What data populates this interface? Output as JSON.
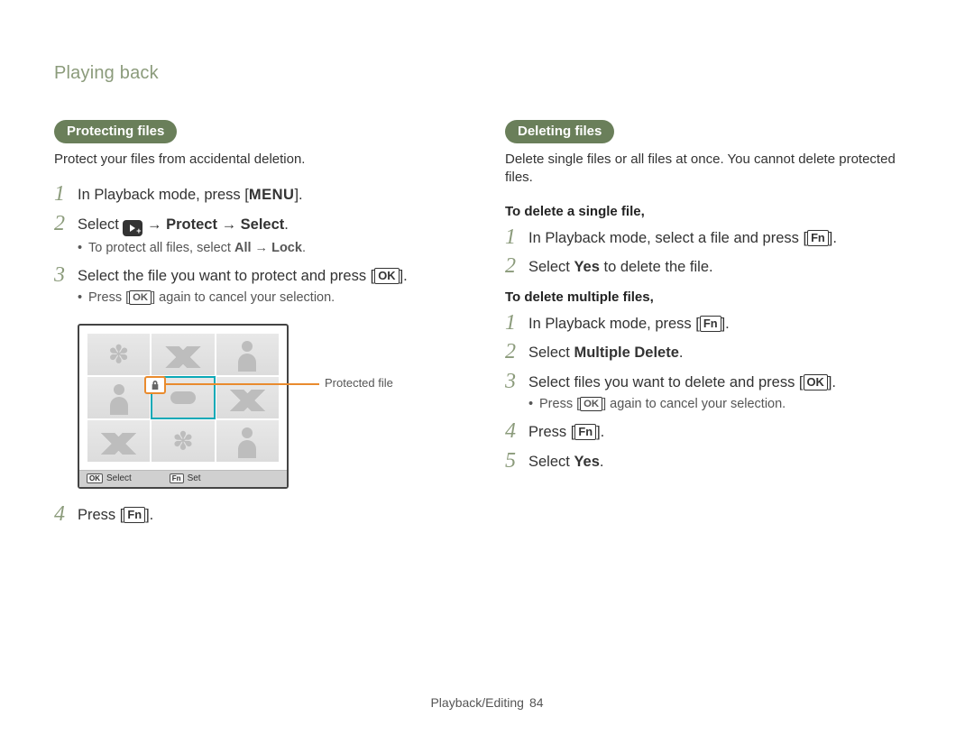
{
  "breadcrumb": "Playing back",
  "left": {
    "pill": "Protecting files",
    "intro": "Protect your files from accidental deletion.",
    "steps": {
      "s1_a": "In Playback mode, press [",
      "s1_menu": "MENU",
      "s1_b": "].",
      "s2_a": "Select ",
      "s2_b": " → ",
      "s2_protect": "Protect",
      "s2_c": " → ",
      "s2_select": "Select",
      "s2_d": ".",
      "s2_sub_a": "To protect all files, select ",
      "s2_sub_all": "All",
      "s2_sub_b": " → ",
      "s2_sub_lock": "Lock",
      "s2_sub_c": ".",
      "s3_a": "Select the file you want to protect and press [",
      "s3_ok": "OK",
      "s3_b": "].",
      "s3_sub_a": "Press [",
      "s3_sub_ok": "OK",
      "s3_sub_b": "] again to cancel your selection.",
      "s4_a": "Press [",
      "s4_fn": "Fn",
      "s4_b": "]."
    },
    "lcd": {
      "callout": "Protected file",
      "f1_key": "OK",
      "f1_label": "Select",
      "f2_key": "Fn",
      "f2_label": "Set"
    }
  },
  "right": {
    "pill": "Deleting files",
    "intro": "Delete single files or all files at once. You cannot delete protected files.",
    "sub1": "To delete a single file,",
    "single": {
      "s1_a": "In Playback mode, select a file and press [",
      "s1_fn": "Fn",
      "s1_b": "].",
      "s2_a": "Select ",
      "s2_yes": "Yes",
      "s2_b": " to delete the file."
    },
    "sub2": "To delete multiple files,",
    "multi": {
      "s1_a": "In Playback mode, press [",
      "s1_fn": "Fn",
      "s1_b": "].",
      "s2_a": "Select ",
      "s2_md": "Multiple Delete",
      "s2_b": ".",
      "s3_a": "Select files you want to delete and press [",
      "s3_ok": "OK",
      "s3_b": "].",
      "s3_sub_a": "Press [",
      "s3_sub_ok": "OK",
      "s3_sub_b": "] again to cancel your selection.",
      "s4_a": "Press [",
      "s4_fn": "Fn",
      "s4_b": "].",
      "s5_a": "Select ",
      "s5_yes": "Yes",
      "s5_b": "."
    }
  },
  "footer": {
    "section": "Playback/Editing",
    "page": "84"
  }
}
